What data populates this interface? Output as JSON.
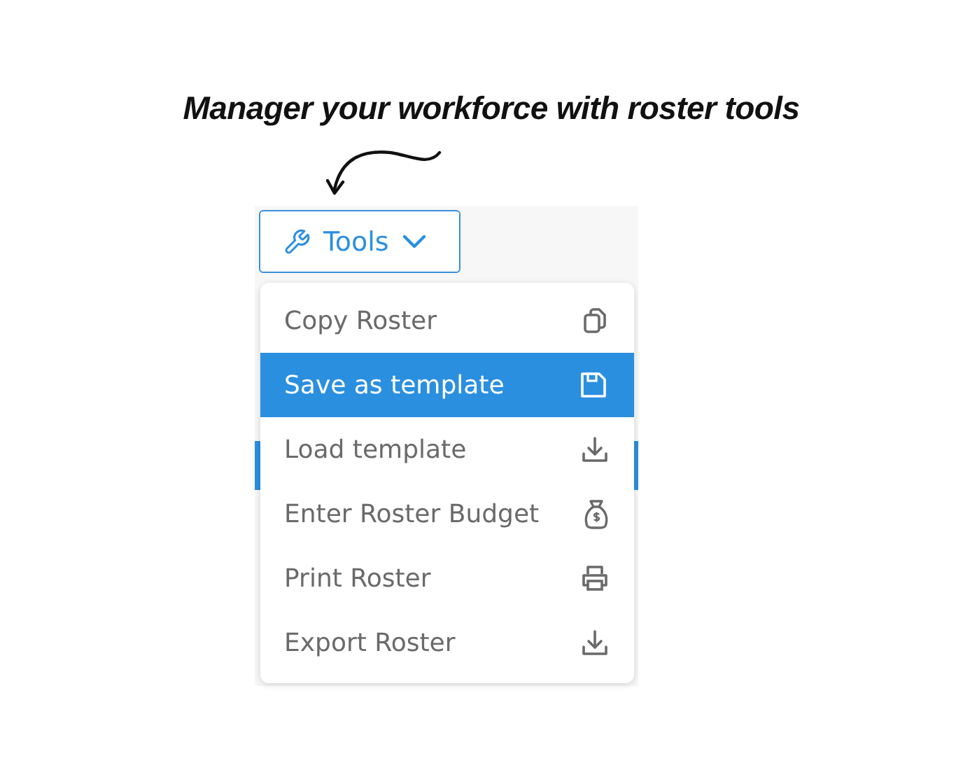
{
  "caption": "Manager your workforce with  roster tools",
  "tools_button": {
    "label": "Tools",
    "expanded": true
  },
  "menu": [
    {
      "label": "Copy Roster",
      "kind": "copy",
      "selected": false
    },
    {
      "label": "Save as template",
      "kind": "save",
      "selected": true
    },
    {
      "label": "Load template",
      "kind": "load",
      "selected": false
    },
    {
      "label": "Enter Roster Budget",
      "kind": "budget",
      "selected": false
    },
    {
      "label": "Print Roster",
      "kind": "print",
      "selected": false
    },
    {
      "label": "Export Roster",
      "kind": "export",
      "selected": false
    }
  ]
}
